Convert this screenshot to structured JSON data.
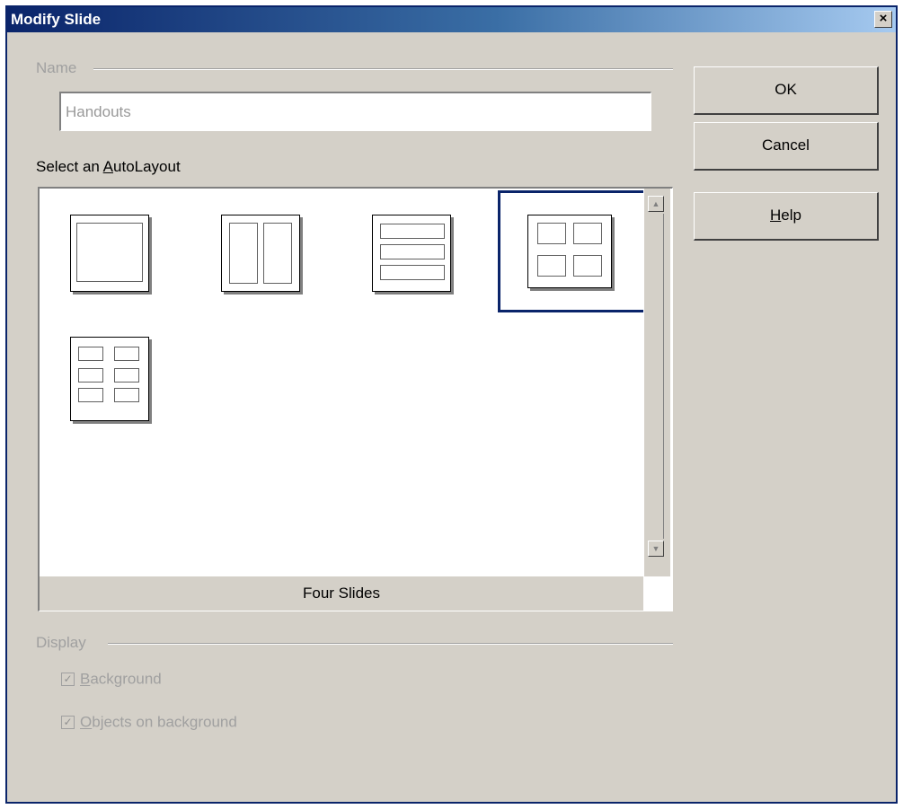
{
  "window": {
    "title": "Modify Slide",
    "close_glyph": "×"
  },
  "name_group": {
    "label": "Name",
    "value": "Handouts"
  },
  "autolayout": {
    "label_prefix": "Select an ",
    "label_accel": "A",
    "label_rest": "utoLayout",
    "selected_caption": "Four Slides",
    "layouts": [
      {
        "id": "one-slide",
        "icon": "layout-one-icon"
      },
      {
        "id": "two-slides",
        "icon": "layout-two-icon"
      },
      {
        "id": "three-slides",
        "icon": "layout-three-icon"
      },
      {
        "id": "four-slides",
        "icon": "layout-four-icon",
        "selected": true
      },
      {
        "id": "six-slides",
        "icon": "layout-six-icon"
      }
    ]
  },
  "display_group": {
    "label": "Display",
    "background": {
      "accel": "B",
      "rest": "ackground",
      "checked": true,
      "enabled": false
    },
    "objects": {
      "accel": "O",
      "rest": "bjects on background",
      "checked": true,
      "enabled": false
    }
  },
  "buttons": {
    "ok": "OK",
    "cancel": "Cancel",
    "help_accel": "H",
    "help_rest": "elp"
  },
  "scrollbar": {
    "up_glyph": "▲",
    "down_glyph": "▼"
  },
  "checkbox_glyph": "✓"
}
